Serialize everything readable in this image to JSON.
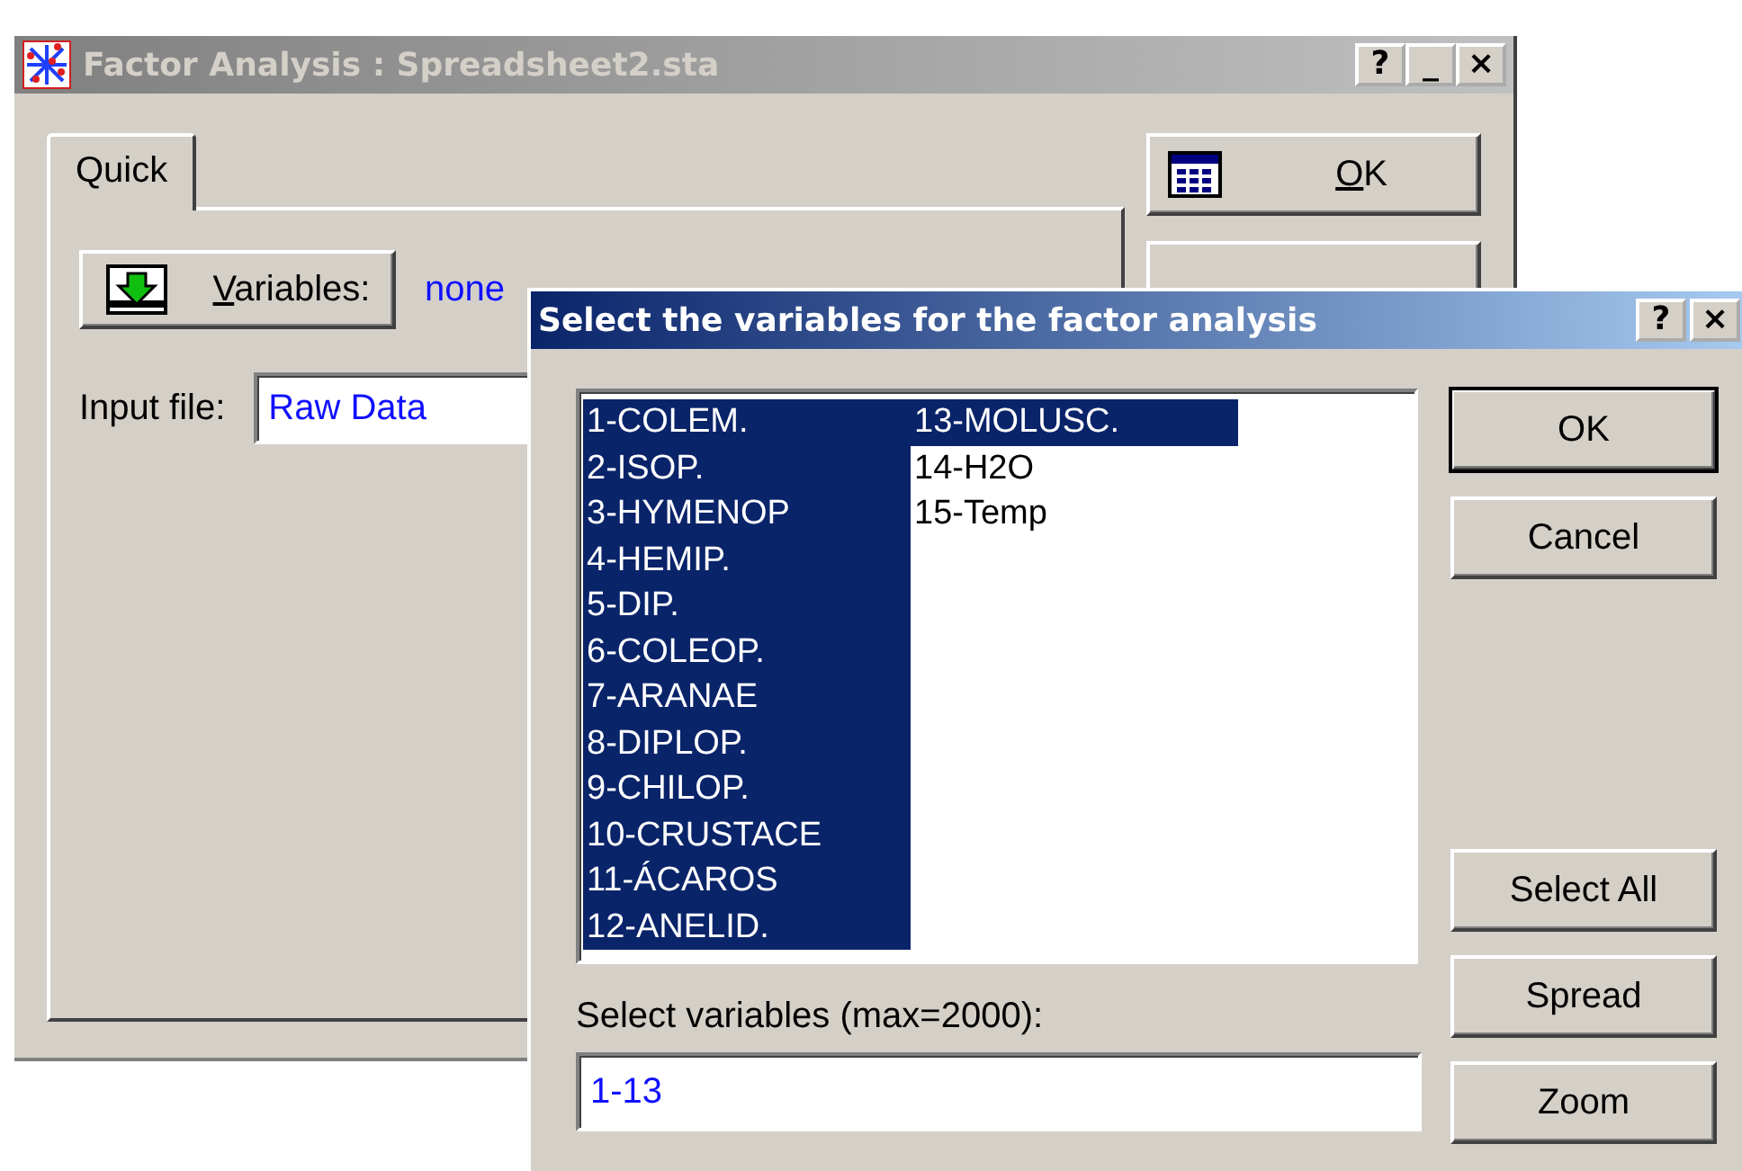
{
  "main_window": {
    "title": "Factor Analysis : Spreadsheet2.sta",
    "title_buttons": [
      "?",
      "_",
      "×"
    ],
    "tabs": [
      {
        "label": "Quick",
        "selected": true
      }
    ],
    "variables_button": {
      "label": "Variables:",
      "first_letter_underlined": true
    },
    "variables_value": "none",
    "input_file": {
      "label": "Input file:",
      "value": "Raw Data"
    },
    "buttons": [
      {
        "label": "OK",
        "first_letter_underlined": true,
        "kind": "icon"
      },
      {
        "kind": "hidden"
      }
    ]
  },
  "dialog": {
    "title": "Select the variables for the factor analysis",
    "title_buttons": [
      "?",
      "×"
    ],
    "variables": [
      {
        "label": "1-COLEM.",
        "selected": true
      },
      {
        "label": "2-ISOP.",
        "selected": true
      },
      {
        "label": "3-HYMENOP",
        "selected": true
      },
      {
        "label": "4-HEMIP.",
        "selected": true
      },
      {
        "label": "5-DIP.",
        "selected": true
      },
      {
        "label": "6-COLEOP.",
        "selected": true
      },
      {
        "label": "7-ARANAE",
        "selected": true
      },
      {
        "label": "8-DIPLOP.",
        "selected": true
      },
      {
        "label": "9-CHILOP.",
        "selected": true
      },
      {
        "label": "10-CRUSTACE",
        "selected": true
      },
      {
        "label": "11-ÁCAROS",
        "selected": true
      },
      {
        "label": "12-ANELID.",
        "selected": true
      },
      {
        "label": "13-MOLUSC.",
        "selected": true
      },
      {
        "label": "14-H2O",
        "selected": false
      },
      {
        "label": "15-Temp",
        "selected": false
      }
    ],
    "select_label": "Select variables (max=2000):",
    "select_value": "1-13",
    "buttons_top": [
      "OK",
      "Cancel"
    ],
    "buttons_bottom": [
      "Select All",
      "Spread",
      "Zoom"
    ]
  }
}
